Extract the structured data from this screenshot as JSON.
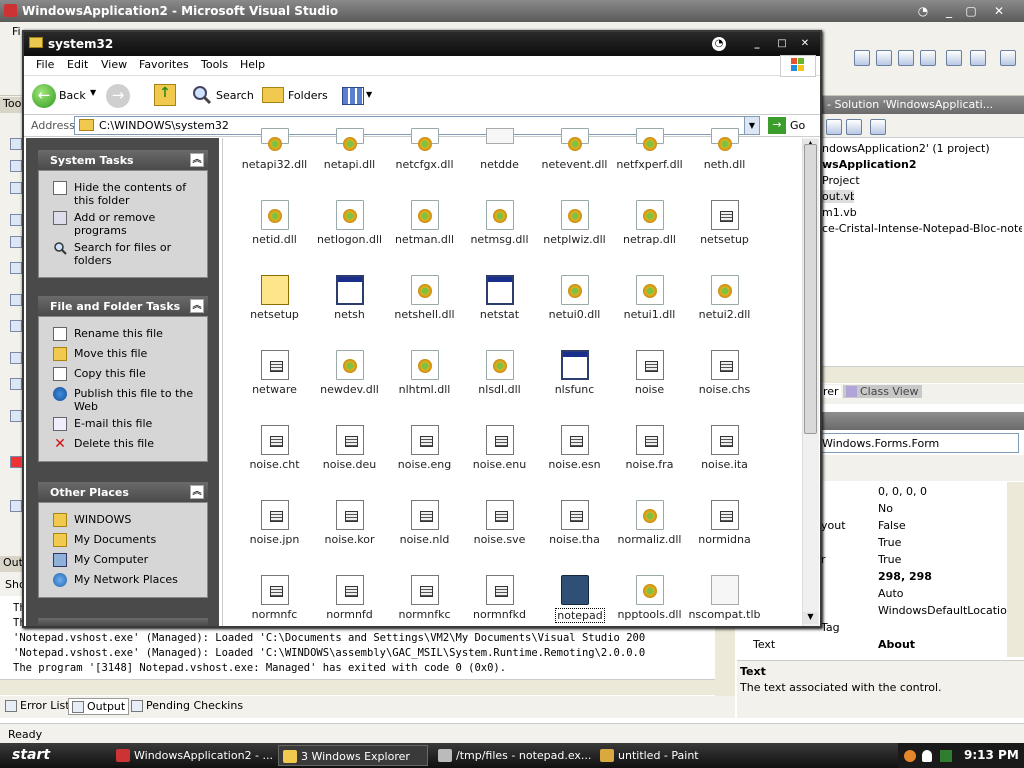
{
  "vs": {
    "title": "WindowsApplication2 - Microsoft Visual Studio",
    "menu_first": "Fi",
    "toolbox_label": "Too",
    "output_label": "Out",
    "show_label": "Sho",
    "status": "Ready",
    "solution": {
      "title": "- Solution 'WindowsApplicati...",
      "lines": [
        "ndowsApplication2' (1 project)",
        "wsApplication2",
        "Project",
        "out.vb",
        "m1.vb",
        "ce-Cristal-Intense-Notepad-Bloc-notes.ico"
      ],
      "tabs": [
        "rer",
        "Class View"
      ]
    },
    "props": {
      "object": "Windows.Forms.Form",
      "rows": [
        {
          "k": "",
          "v": "0, 0, 0, 0"
        },
        {
          "k": "",
          "v": "No"
        },
        {
          "k": "yout",
          "v": "False"
        },
        {
          "k": "",
          "v": "True"
        },
        {
          "k": "r",
          "v": "True"
        },
        {
          "k": "",
          "v": "298, 298"
        },
        {
          "k": "",
          "v": "Auto"
        },
        {
          "k": "",
          "v": "WindowsDefaultLocation"
        },
        {
          "k": "Tag",
          "v": ""
        },
        {
          "k": "Text",
          "v": "About"
        }
      ],
      "desc_title": "Text",
      "desc_text": "The text associated with the control."
    },
    "output": {
      "lines": [
        "Th",
        "Th",
        "'Notepad.vshost.exe' (Managed): Loaded 'C:\\Documents and Settings\\VM2\\My Documents\\Visual Studio 200",
        "'Notepad.vshost.exe' (Managed): Loaded 'C:\\WINDOWS\\assembly\\GAC_MSIL\\System.Runtime.Remoting\\2.0.0.0",
        "The program '[3148] Notepad.vshost.exe: Managed' has exited with code 0 (0x0)."
      ]
    },
    "bottom_tabs": [
      "Error List",
      "Output",
      "Pending Checkins"
    ]
  },
  "explorer": {
    "title": "system32",
    "menu": [
      "File",
      "Edit",
      "View",
      "Favorites",
      "Tools",
      "Help"
    ],
    "back_label": "Back",
    "search_label": "Search",
    "folders_label": "Folders",
    "address_label": "Address",
    "address": "C:\\WINDOWS\\system32",
    "go_label": "Go",
    "system_tasks": {
      "title": "System Tasks",
      "items": [
        "Hide the contents of this folder",
        "Add or remove programs",
        "Search for files or folders"
      ]
    },
    "file_tasks": {
      "title": "File and Folder Tasks",
      "items": [
        "Rename this file",
        "Move this file",
        "Copy this file",
        "Publish this file to the Web",
        "E-mail this file",
        "Delete this file"
      ]
    },
    "other_places": {
      "title": "Other Places",
      "items": [
        "WINDOWS",
        "My Documents",
        "My Computer",
        "My Network Places"
      ]
    },
    "files": [
      {
        "n": "netapi32.dll",
        "t": "dll"
      },
      {
        "n": "netapi.dll",
        "t": "dll"
      },
      {
        "n": "netcfgx.dll",
        "t": "dll"
      },
      {
        "n": "netdde",
        "t": "doc"
      },
      {
        "n": "netevent.dll",
        "t": "dll"
      },
      {
        "n": "netfxperf.dll",
        "t": "dll"
      },
      {
        "n": "neth.dll",
        "t": "dll"
      },
      {
        "n": "netid.dll",
        "t": "dll"
      },
      {
        "n": "netlogon.dll",
        "t": "dll"
      },
      {
        "n": "netman.dll",
        "t": "dll"
      },
      {
        "n": "netmsg.dll",
        "t": "dll"
      },
      {
        "n": "netplwiz.dll",
        "t": "dll"
      },
      {
        "n": "netrap.dll",
        "t": "dll"
      },
      {
        "n": "netsetup",
        "t": "txt"
      },
      {
        "n": "netsetup",
        "t": "bat"
      },
      {
        "n": "netsh",
        "t": "win"
      },
      {
        "n": "netshell.dll",
        "t": "dll"
      },
      {
        "n": "netstat",
        "t": "win"
      },
      {
        "n": "netui0.dll",
        "t": "dll"
      },
      {
        "n": "netui1.dll",
        "t": "dll"
      },
      {
        "n": "netui2.dll",
        "t": "dll"
      },
      {
        "n": "netware",
        "t": "txt"
      },
      {
        "n": "newdev.dll",
        "t": "dll"
      },
      {
        "n": "nlhtml.dll",
        "t": "dll"
      },
      {
        "n": "nlsdl.dll",
        "t": "dll"
      },
      {
        "n": "nlsfunc",
        "t": "win"
      },
      {
        "n": "noise",
        "t": "txt"
      },
      {
        "n": "noise.chs",
        "t": "txt"
      },
      {
        "n": "noise.cht",
        "t": "txt"
      },
      {
        "n": "noise.deu",
        "t": "txt"
      },
      {
        "n": "noise.eng",
        "t": "txt"
      },
      {
        "n": "noise.enu",
        "t": "txt"
      },
      {
        "n": "noise.esn",
        "t": "txt"
      },
      {
        "n": "noise.fra",
        "t": "txt"
      },
      {
        "n": "noise.ita",
        "t": "txt"
      },
      {
        "n": "noise.jpn",
        "t": "txt"
      },
      {
        "n": "noise.kor",
        "t": "txt"
      },
      {
        "n": "noise.nld",
        "t": "txt"
      },
      {
        "n": "noise.sve",
        "t": "txt"
      },
      {
        "n": "noise.tha",
        "t": "txt"
      },
      {
        "n": "normaliz.dll",
        "t": "dll"
      },
      {
        "n": "normidna",
        "t": "txt"
      },
      {
        "n": "normnfc",
        "t": "txt"
      },
      {
        "n": "normnfd",
        "t": "txt"
      },
      {
        "n": "normnfkc",
        "t": "txt"
      },
      {
        "n": "normnfkd",
        "t": "txt"
      },
      {
        "n": "notepad",
        "t": "note",
        "sel": true
      },
      {
        "n": "npptools.dll",
        "t": "dll"
      },
      {
        "n": "nscompat.tlb",
        "t": "doc"
      }
    ]
  },
  "taskbar": {
    "start": "start",
    "tasks": [
      "WindowsApplication2 - ...",
      "3 Windows Explorer",
      "/tmp/files - notepad.ex...",
      "untitled - Paint"
    ],
    "clock": "9:13 PM"
  }
}
